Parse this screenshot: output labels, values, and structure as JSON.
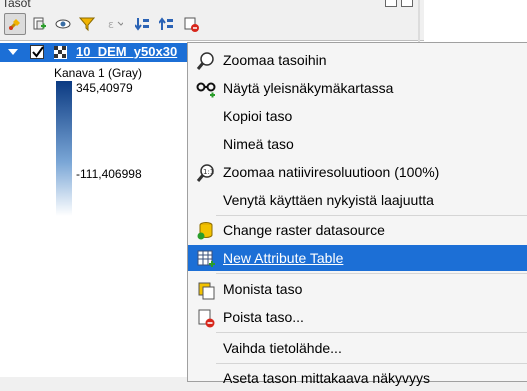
{
  "panel": {
    "title": "Tasot",
    "tools": [
      "paint-brush-icon",
      "add-group-icon",
      "eye-icon",
      "filter-icon",
      "expression-icon",
      "expand-all-icon",
      "collapse-all-icon",
      "remove-layer-icon"
    ]
  },
  "layer": {
    "name": "10_DEM_y50x30",
    "band_label": "Kanava 1 (Gray)",
    "max": "345,40979",
    "min": "-111,406998"
  },
  "menu": {
    "items": [
      {
        "label": "Zoomaa tasoihin",
        "icon": "zoom-icon"
      },
      {
        "label": "Näytä yleisnäkymäkartassa",
        "icon": "glasses-icon"
      },
      {
        "label": "Kopioi taso",
        "icon": ""
      },
      {
        "label": "Nimeä taso",
        "icon": ""
      },
      {
        "label": "Zoomaa natiiviresoluutioon (100%)",
        "icon": "zoom-native-icon"
      },
      {
        "label": "Venytä käyttäen nykyistä laajuutta",
        "icon": ""
      },
      {
        "label": "Change raster datasource",
        "icon": "datasource-icon"
      },
      {
        "label": "New Attribute Table",
        "icon": "attribute-table-icon"
      },
      {
        "label": "Monista taso",
        "icon": "duplicate-icon"
      },
      {
        "label": "Poista taso...",
        "icon": "remove-icon"
      },
      {
        "label": "Vaihda tietolähde...",
        "icon": ""
      },
      {
        "label": "Aseta tason mittakaava näkyvyys",
        "icon": ""
      }
    ],
    "highlighted": "New Attribute Table"
  },
  "colors": {
    "selection": "#1c6fd6",
    "ramp_top": "#0b3a82",
    "ramp_bottom": "#ffffff"
  }
}
